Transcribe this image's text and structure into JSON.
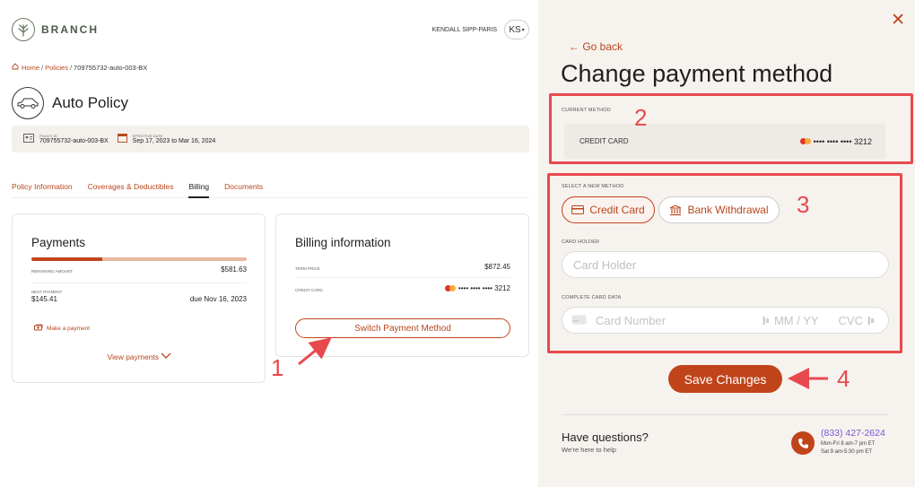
{
  "app": {
    "brand": "BRANCH",
    "user_name": "KENDALL SIPP-PARIS",
    "user_initials": "KS"
  },
  "breadcrumb": {
    "home": "Home",
    "policies": "Policies",
    "current": "709755732-auto-003-BX"
  },
  "policy": {
    "title": "Auto Policy",
    "id_label": "POLICY ID",
    "id_value": "709755732-auto-003-BX",
    "date_label": "EFFECTIVE DATE",
    "date_value": "Sep 17, 2023 to Mar 16, 2024"
  },
  "tabs": [
    {
      "label": "Policy Information",
      "active": false
    },
    {
      "label": "Coverages & Deductibles",
      "active": false
    },
    {
      "label": "Billing",
      "active": true
    },
    {
      "label": "Documents",
      "active": false
    }
  ],
  "payments": {
    "title": "Payments",
    "progress_paid_fraction": 0.33,
    "remaining_label": "REMAINING AMOUNT",
    "remaining_value": "$581.63",
    "next_label": "NEXT PAYMENT",
    "next_amount": "$145.41",
    "next_due": "due Nov 16, 2023",
    "make_payment": "Make a payment",
    "view_payments": "View payments"
  },
  "billing": {
    "title": "Billing information",
    "term_label": "TERM PRICE",
    "term_value": "$872.45",
    "card_label": "CREDIT CARD",
    "card_masked": "•••• •••• •••• 3212",
    "switch_button": "Switch Payment Method"
  },
  "panel": {
    "go_back": "← Go back",
    "title": "Change payment method",
    "current_section": "CURRENT METHOD",
    "current_label": "CREDIT CARD",
    "current_card": "•••• •••• •••• 3212",
    "new_section": "SELECT A NEW METHOD",
    "method_credit": "Credit Card",
    "method_bank": "Bank Withdrawal",
    "holder_label": "CARD HOLDER",
    "holder_placeholder": "Card Holder",
    "data_label": "COMPLETE CARD DATA",
    "card_number_placeholder": "Card Number",
    "expiry_placeholder": "MM / YY",
    "cvc_placeholder": "CVC",
    "save_button": "Save Changes",
    "help_title": "Have questions?",
    "help_sub": "We're here to help",
    "phone": "(833) 427-2624",
    "hours_weekday": "Mon-Fri 8 am-7 pm ET",
    "hours_saturday": "Sat 9 am-5:30 pm ET"
  },
  "annotations": [
    "1",
    "2",
    "3",
    "4"
  ],
  "colors": {
    "accent": "#c0441a",
    "annotation": "#e8494e",
    "phone_link": "#7a55d6"
  }
}
